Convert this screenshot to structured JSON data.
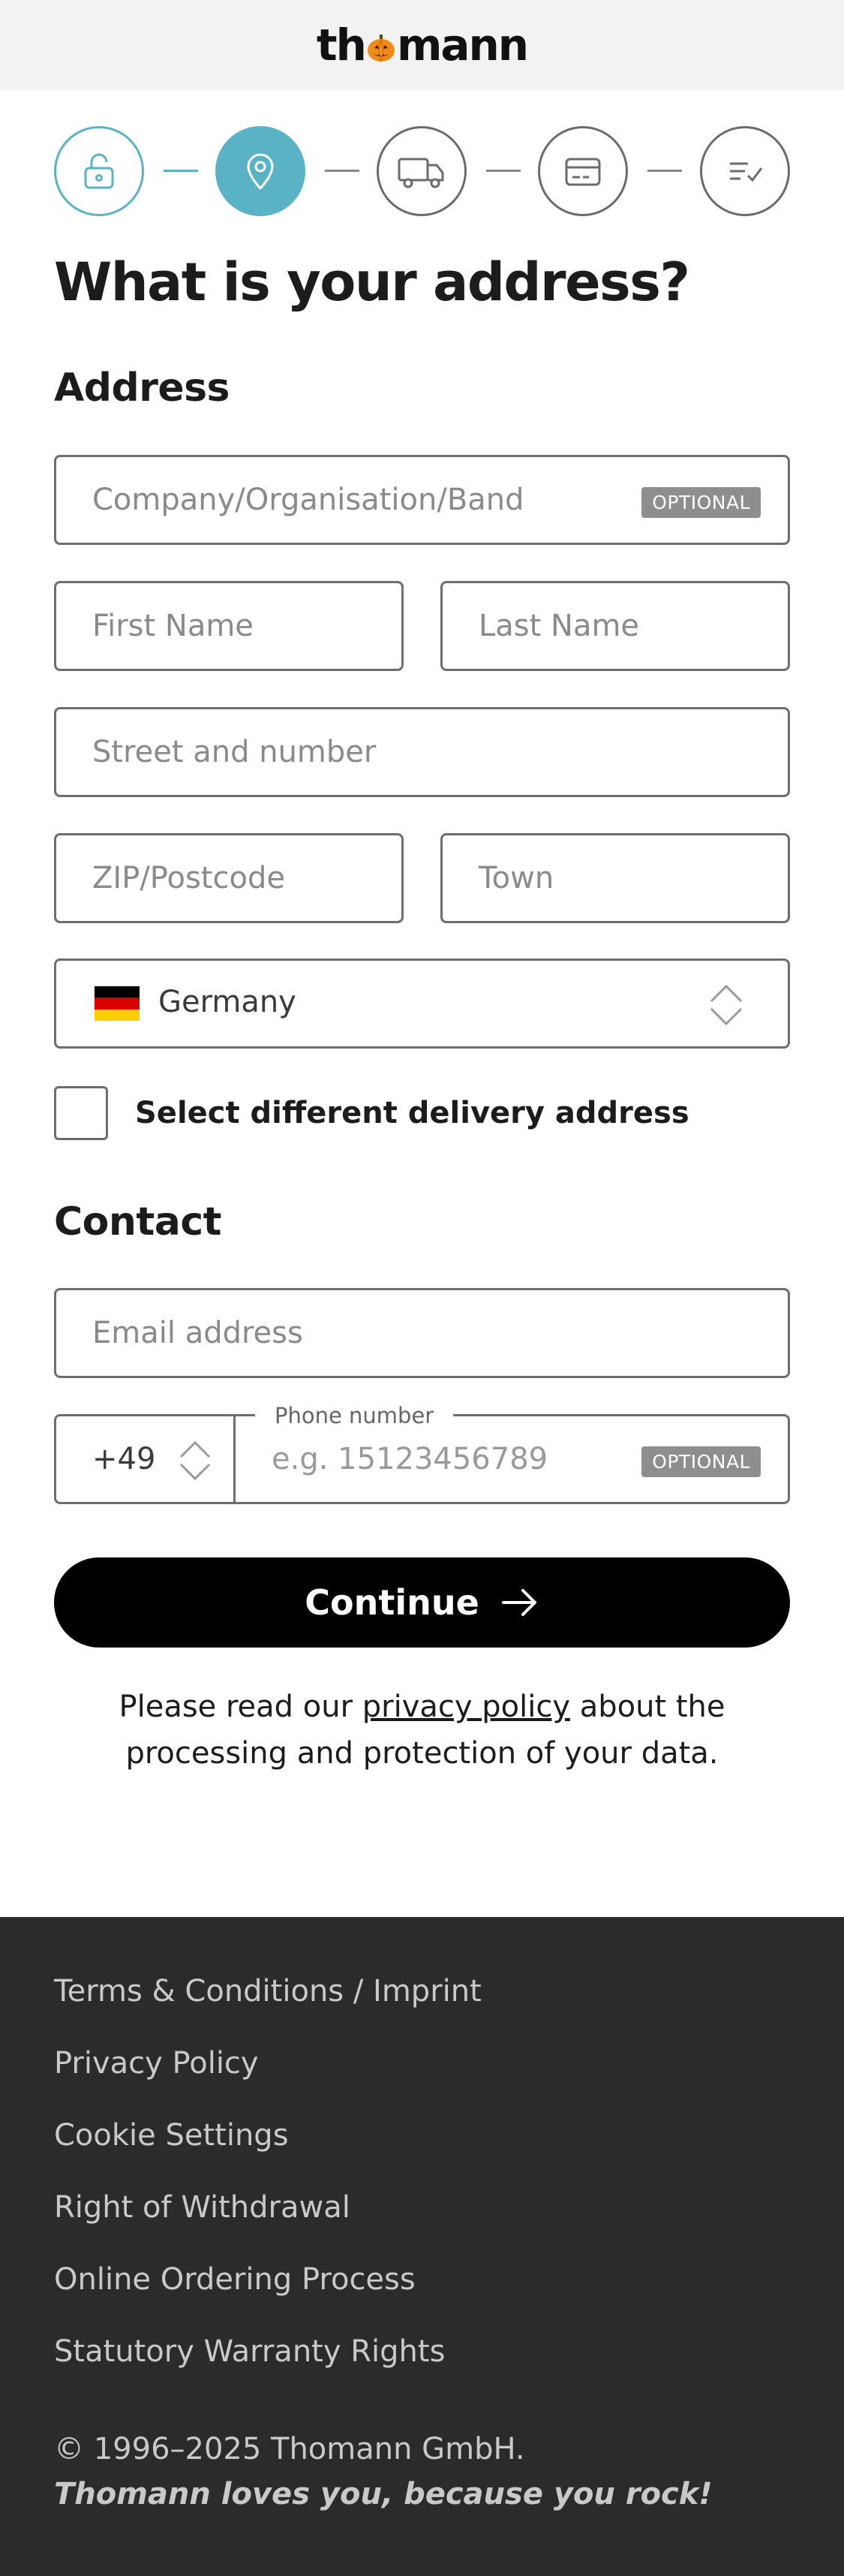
{
  "header": {
    "logo_pre": "th",
    "logo_post": "mann",
    "logo_alt": "thomann"
  },
  "stepper": {
    "steps": [
      {
        "icon": "unlock-icon",
        "state": "done"
      },
      {
        "icon": "location-pin-icon",
        "state": "active"
      },
      {
        "icon": "truck-icon",
        "state": "todo"
      },
      {
        "icon": "credit-card-icon",
        "state": "todo"
      },
      {
        "icon": "checklist-icon",
        "state": "todo"
      }
    ],
    "accent_color": "#5ab3c4"
  },
  "page": {
    "title": "What is your address?"
  },
  "address": {
    "heading": "Address",
    "company_placeholder": "Company/Organisation/Band",
    "optional_badge": "OPTIONAL",
    "first_name_placeholder": "First Name",
    "last_name_placeholder": "Last Name",
    "street_placeholder": "Street and number",
    "zip_placeholder": "ZIP/Postcode",
    "town_placeholder": "Town",
    "country": {
      "value": "Germany",
      "flag_icon": "germany-flag-icon"
    },
    "different_delivery_label": "Select different delivery address",
    "different_delivery_checked": false
  },
  "contact": {
    "heading": "Contact",
    "email_placeholder": "Email address",
    "phone_code": "+49",
    "phone_label": "Phone number",
    "phone_placeholder": "e.g. 15123456789",
    "optional_badge": "OPTIONAL"
  },
  "actions": {
    "continue_label": "Continue"
  },
  "privacy": {
    "text_before": "Please read our ",
    "link": "privacy policy",
    "text_after": " about the processing and protection of your data."
  },
  "footer": {
    "links": [
      "Terms & Conditions / Imprint",
      "Privacy Policy",
      "Cookie Settings",
      "Right of Withdrawal",
      "Online Ordering Process",
      "Statutory Warranty Rights"
    ],
    "copyright": "© 1996–2025 Thomann GmbH.",
    "tagline": "Thomann loves you, because you rock!"
  }
}
